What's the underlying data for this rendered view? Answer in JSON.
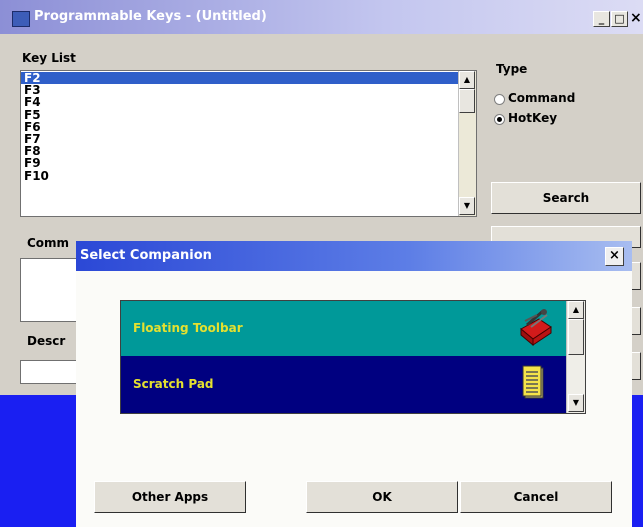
{
  "main_window": {
    "title": "Programmable Keys - (Untitled)",
    "key_list": {
      "label": "Key List",
      "items": [
        "F2",
        "F3",
        "F4",
        "F5",
        "F6",
        "F7",
        "F8",
        "F9",
        "F10"
      ],
      "selected": "F2"
    },
    "type_group": {
      "label": "Type",
      "options": [
        "Command",
        "HotKey"
      ],
      "selected": "HotKey"
    },
    "search_button": "Search",
    "command_label": "Comm",
    "description_label": "Descr"
  },
  "dialog": {
    "title": "Select Companion",
    "list_items": [
      {
        "label": "Floating Toolbar",
        "icon": "toolbox-icon",
        "bg": "#009999"
      },
      {
        "label": "Scratch Pad",
        "icon": "notepad-icon",
        "bg": "#000080"
      }
    ],
    "buttons": {
      "other_apps": "Other Apps",
      "ok": "OK",
      "cancel": "Cancel"
    }
  },
  "colors": {
    "selection": "#2f5fc9",
    "background_blue": "#1a1ff2",
    "list_text": "#e4e030"
  }
}
